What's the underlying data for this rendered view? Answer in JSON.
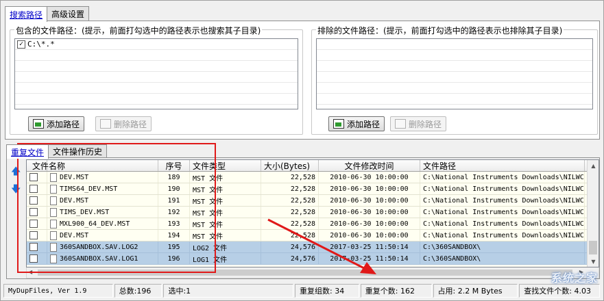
{
  "top_tabs": [
    {
      "label": "搜索路径",
      "active": true
    },
    {
      "label": "高级设置",
      "active": false
    }
  ],
  "include_panel": {
    "legend": "包含的文件路径：(提示，前面打勾选中的路径表示也搜索其子目录)",
    "items": [
      {
        "checked": true,
        "path": "C:\\*.*"
      }
    ],
    "add_button": "添加路径",
    "delete_button": "删除路径"
  },
  "exclude_panel": {
    "legend": "排除的文件路径：(提示，前面打勾选中的路径表示也排除其子目录)",
    "items": [],
    "add_button": "添加路径",
    "delete_button": "删除路径"
  },
  "bottom_tabs": [
    {
      "label": "重复文件",
      "active": true
    },
    {
      "label": "文件操作历史",
      "active": false
    }
  ],
  "table": {
    "columns": [
      "文件名称",
      "序号",
      "文件类型",
      "大小(Bytes)",
      "文件修改时间",
      "文件路径"
    ],
    "rows": [
      {
        "name": "DEV.MST",
        "index": "189",
        "type": "MST 文件",
        "size": "22,528",
        "mtime": "2010-06-30 10:00:00",
        "path": "C:\\National Instruments Downloads\\NILWCV",
        "selected": false
      },
      {
        "name": "TIMS64_DEV.MST",
        "index": "190",
        "type": "MST 文件",
        "size": "22,528",
        "mtime": "2010-06-30 10:00:00",
        "path": "C:\\National Instruments Downloads\\NILWCV",
        "selected": false
      },
      {
        "name": "DEV.MST",
        "index": "191",
        "type": "MST 文件",
        "size": "22,528",
        "mtime": "2010-06-30 10:00:00",
        "path": "C:\\National Instruments Downloads\\NILWCV",
        "selected": false
      },
      {
        "name": "TIMS_DEV.MST",
        "index": "192",
        "type": "MST 文件",
        "size": "22,528",
        "mtime": "2010-06-30 10:00:00",
        "path": "C:\\National Instruments Downloads\\NILWCV",
        "selected": false
      },
      {
        "name": "MXL900_64_DEV.MST",
        "index": "193",
        "type": "MST 文件",
        "size": "22,528",
        "mtime": "2010-06-30 10:00:00",
        "path": "C:\\National Instruments Downloads\\NILWCV",
        "selected": false
      },
      {
        "name": "DEV.MST",
        "index": "194",
        "type": "MST 文件",
        "size": "22,528",
        "mtime": "2010-06-30 10:00:00",
        "path": "C:\\National Instruments Downloads\\NILWCV",
        "selected": false
      },
      {
        "name": "360SANDBOX.SAV.LOG2",
        "index": "195",
        "type": "LOG2 文件",
        "size": "24,576",
        "mtime": "2017-03-25 11:50:14",
        "path": "C:\\360SANDBOX\\",
        "selected": true
      },
      {
        "name": "360SANDBOX.SAV.LOG1",
        "index": "196",
        "type": "LOG1 文件",
        "size": "24,576",
        "mtime": "2017-03-25 11:50:14",
        "path": "C:\\360SANDBOX\\",
        "selected": true
      }
    ]
  },
  "status": {
    "version": "MyDupFiles, Ver 1.9",
    "total": "总数:196",
    "selected": "选中:1",
    "dup_groups": "重复组数: 34",
    "dup_count": "重复个数: 162",
    "occupied": "占用: 2.2 M Bytes",
    "found_count": "查找文件个数: 4.03"
  },
  "watermark": "系统之家",
  "colors": {
    "accent_tab": "#0000c8",
    "selected_row": "#b7cfe6",
    "row_bg": "#fffff2",
    "annotation": "#e01919"
  }
}
